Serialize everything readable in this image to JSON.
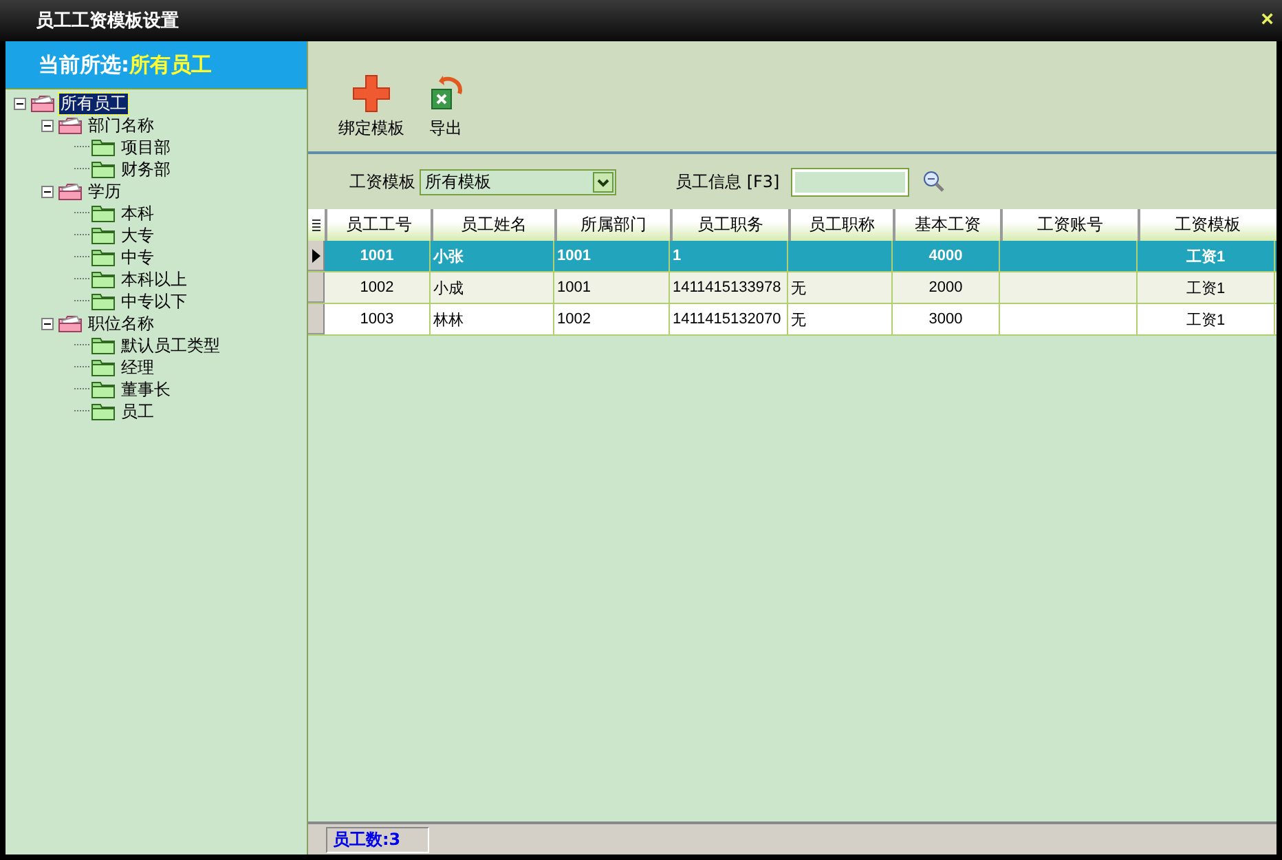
{
  "window": {
    "title": "员工工资模板设置",
    "close": "×"
  },
  "sidebar": {
    "header_label": "当前所选:",
    "header_value": "所有员工",
    "tree": [
      {
        "label": "所有员工",
        "expanded": true,
        "selected": true,
        "children": [
          {
            "label": "部门名称",
            "expanded": true,
            "selected": false,
            "children": [
              {
                "label": "项目部",
                "selected": false
              },
              {
                "label": "财务部",
                "selected": false
              }
            ]
          },
          {
            "label": "学历",
            "expanded": true,
            "selected": false,
            "children": [
              {
                "label": "本科",
                "selected": false
              },
              {
                "label": "大专",
                "selected": false
              },
              {
                "label": "中专",
                "selected": false
              },
              {
                "label": "本科以上",
                "selected": false
              },
              {
                "label": "中专以下",
                "selected": false
              }
            ]
          },
          {
            "label": "职位名称",
            "expanded": true,
            "selected": false,
            "children": [
              {
                "label": "默认员工类型",
                "selected": false
              },
              {
                "label": "经理",
                "selected": false
              },
              {
                "label": "董事长",
                "selected": false
              },
              {
                "label": "员工",
                "selected": false
              }
            ]
          }
        ]
      }
    ]
  },
  "toolbar": [
    {
      "label": "绑定模板",
      "kind": "add"
    },
    {
      "label": "导出",
      "kind": "export"
    }
  ],
  "filter": {
    "template_label": "工资模板",
    "template_value": "所有模板",
    "search_label": "员工信息 [F3]"
  },
  "table": {
    "columns": [
      "员工工号",
      "员工姓名",
      "所属部门",
      "员工职务",
      "员工职称",
      "基本工资",
      "工资账号",
      "工资模板"
    ],
    "rows": [
      {
        "selected": true,
        "cells": [
          "1001",
          "小张",
          "1001",
          "1",
          "",
          "4000",
          "",
          "工资1"
        ]
      },
      {
        "selected": false,
        "cells": [
          "1002",
          "小成",
          "1001",
          "1411415133978",
          "无",
          "2000",
          "",
          "工资1"
        ]
      },
      {
        "selected": false,
        "cells": [
          "1003",
          "林林",
          "1002",
          "1411415132070",
          "无",
          "3000",
          "",
          "工资1"
        ]
      }
    ]
  },
  "status_bar": {
    "count": "员工数:3"
  }
}
